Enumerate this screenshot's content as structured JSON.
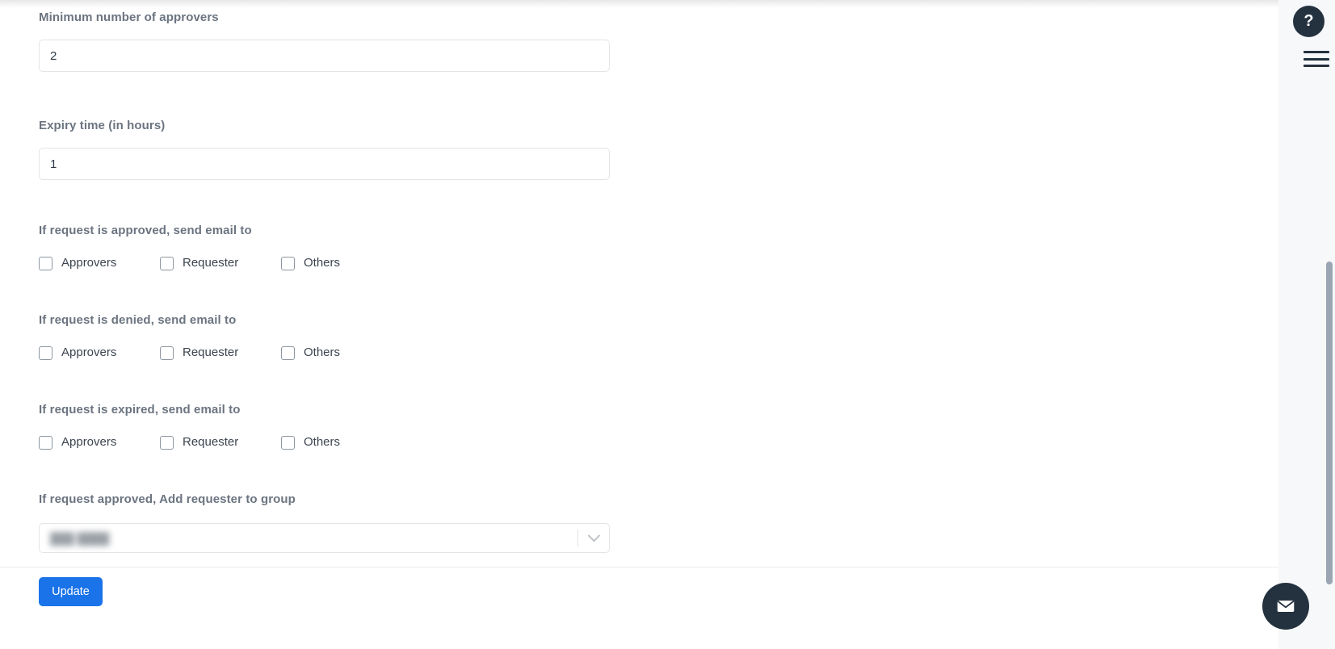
{
  "form": {
    "fields": [
      {
        "id": "min-approvers",
        "label": "Minimum number of approvers",
        "value": "2",
        "placeholder": ""
      },
      {
        "id": "expiry-time",
        "label": "Expiry time (in hours)",
        "value": "1",
        "placeholder": ""
      }
    ],
    "checkbox_sections": [
      {
        "id": "approved",
        "label": "If request is approved, send email to",
        "options": [
          {
            "label": "Approvers",
            "checked": false
          },
          {
            "label": "Requester",
            "checked": false
          },
          {
            "label": "Others",
            "checked": false
          }
        ]
      },
      {
        "id": "denied",
        "label": "If request is denied, send email to",
        "options": [
          {
            "label": "Approvers",
            "checked": false
          },
          {
            "label": "Requester",
            "checked": false
          },
          {
            "label": "Others",
            "checked": false
          }
        ]
      },
      {
        "id": "expired",
        "label": "If request is expired, send email to",
        "options": [
          {
            "label": "Approvers",
            "checked": false
          },
          {
            "label": "Requester",
            "checked": false
          },
          {
            "label": "Others",
            "checked": false
          }
        ]
      }
    ],
    "group_select": {
      "label": "If request approved, Add requester to group",
      "value": "",
      "placeholder": ""
    }
  },
  "footer": {
    "update_label": "Update"
  },
  "widgets": {
    "help_label": "?",
    "help_icon": "question-mark-icon",
    "menu_icon": "hamburger-menu-icon",
    "mail_icon": "envelope-icon"
  },
  "colors": {
    "accent": "#1a73e8",
    "fab_dark": "#24313f",
    "label_gray": "#6b7480",
    "border_gray": "#e2e4e7",
    "scrollbar": "#9aa6b4"
  }
}
